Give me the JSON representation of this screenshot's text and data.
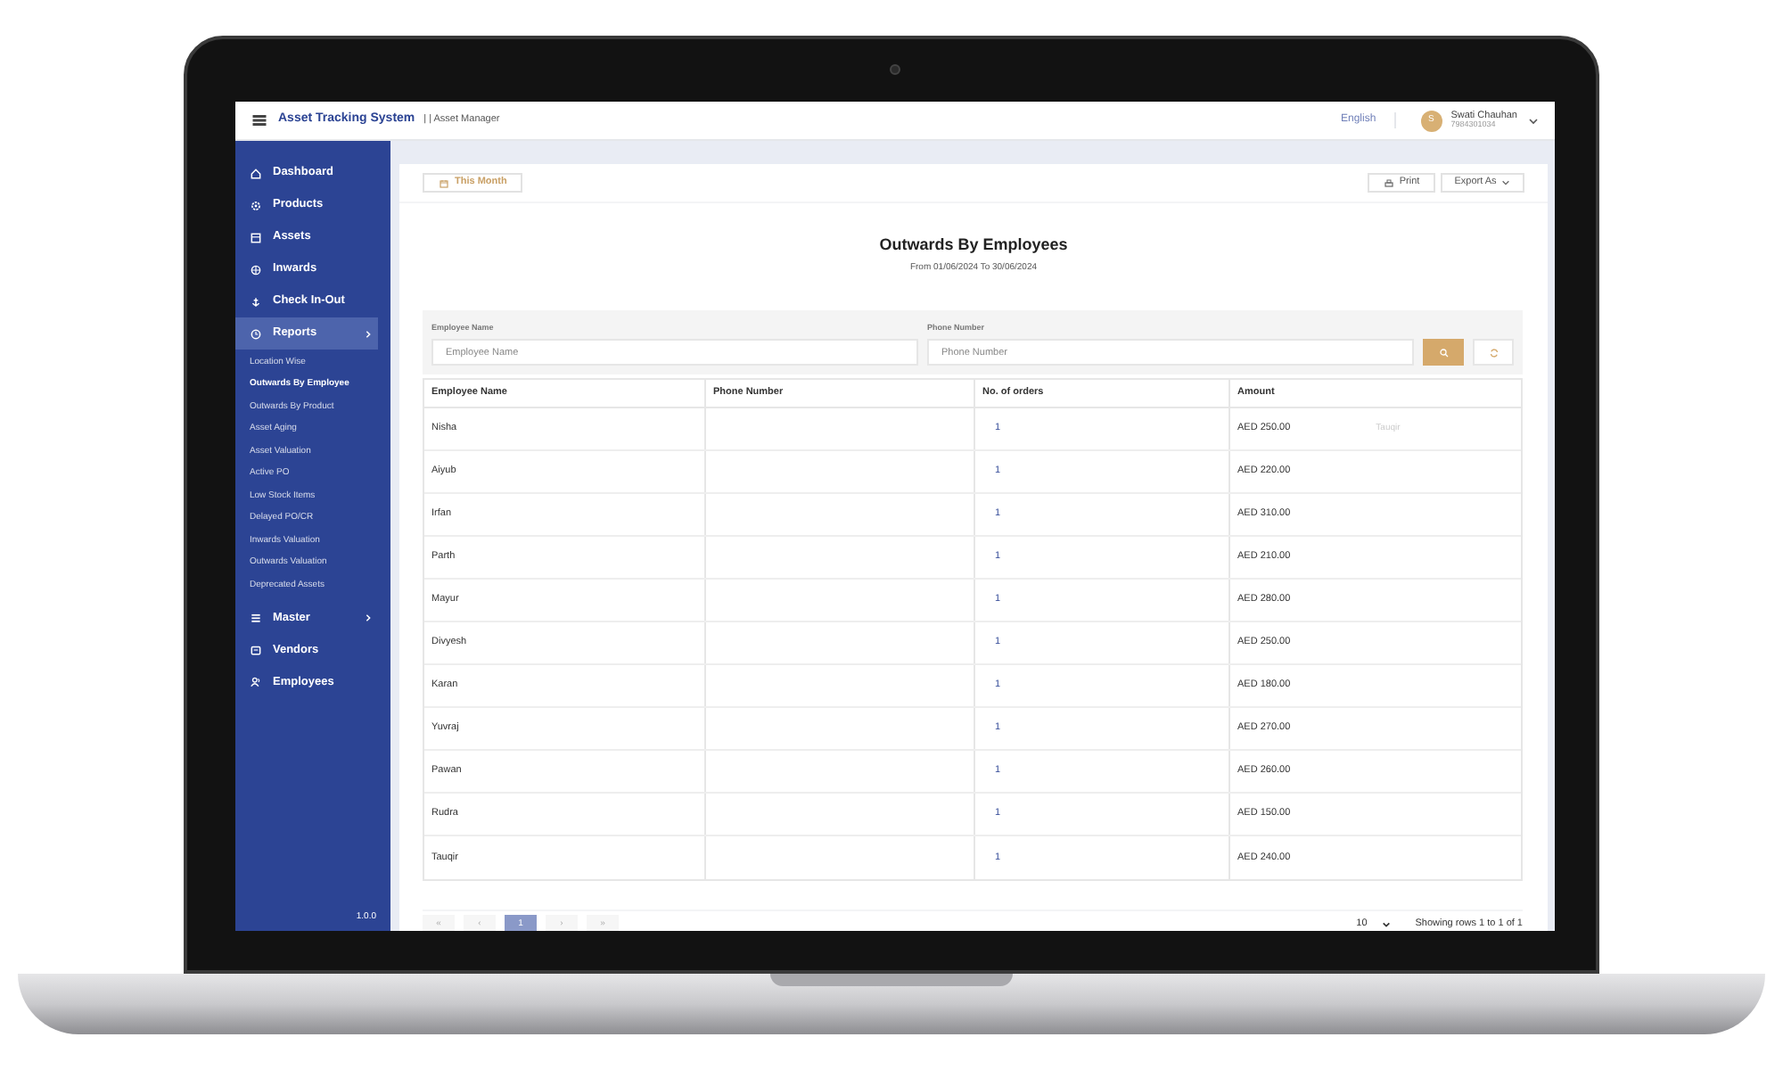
{
  "app": {
    "title": "Asset Tracking System",
    "subtitle": "| | Asset Manager",
    "language": "English",
    "user": {
      "initial": "S",
      "name": "Swati Chauhan",
      "phone": "7984301034"
    }
  },
  "sidebar": {
    "items": [
      {
        "label": "Dashboard",
        "selected": false,
        "submenu": false
      },
      {
        "label": "Products",
        "selected": false,
        "submenu": false
      },
      {
        "label": "Assets",
        "selected": false,
        "submenu": false
      },
      {
        "label": "Inwards",
        "selected": false,
        "submenu": false
      },
      {
        "label": "Check In-Out",
        "selected": false,
        "submenu": false
      },
      {
        "label": "Reports",
        "selected": true,
        "submenu": true,
        "children": [
          {
            "label": "Location Wise",
            "selected": false
          },
          {
            "label": "Outwards By Employee",
            "selected": true
          },
          {
            "label": "Outwards By Product",
            "selected": false
          },
          {
            "label": "Asset Aging",
            "selected": false
          },
          {
            "label": "Asset Valuation",
            "selected": false
          },
          {
            "label": "Active PO",
            "selected": false
          },
          {
            "label": "Low Stock Items",
            "selected": false
          },
          {
            "label": "Delayed PO/CR",
            "selected": false
          },
          {
            "label": "Inwards Valuation",
            "selected": false
          },
          {
            "label": "Outwards Valuation",
            "selected": false
          },
          {
            "label": "Deprecated Assets",
            "selected": false
          }
        ]
      },
      {
        "label": "Master",
        "selected": false,
        "submenu": true
      },
      {
        "label": "Vendors",
        "selected": false,
        "submenu": false
      },
      {
        "label": "Employees",
        "selected": false,
        "submenu": false
      }
    ],
    "version": "1.0.0"
  },
  "toolbar": {
    "period": "This Month",
    "print": "Print",
    "export": "Export As"
  },
  "report": {
    "title": "Outwards By Employees",
    "range": "From 01/06/2024 To 30/06/2024"
  },
  "filters": [
    {
      "label": "Employee Name",
      "placeholder": "Employee Name"
    },
    {
      "label": "Phone Number",
      "placeholder": "Phone Number"
    }
  ],
  "table": {
    "columns": [
      "Employee Name",
      "Phone Number",
      "No. of orders",
      "Amount"
    ],
    "rows": [
      {
        "employee": "Nisha",
        "orders": "1",
        "amount": "AED 250.00",
        "hover_text": "Tauqir"
      },
      {
        "employee": "Aiyub",
        "orders": "1",
        "amount": "AED 220.00"
      },
      {
        "employee": "Irfan",
        "orders": "1",
        "amount": "AED 310.00"
      },
      {
        "employee": "Parth",
        "orders": "1",
        "amount": "AED 210.00"
      },
      {
        "employee": "Mayur",
        "orders": "1",
        "amount": "AED 280.00"
      },
      {
        "employee": "Divyesh",
        "orders": "1",
        "amount": "AED 250.00"
      },
      {
        "employee": "Karan",
        "orders": "1",
        "amount": "AED 180.00"
      },
      {
        "employee": "Yuvraj",
        "orders": "1",
        "amount": "AED 270.00"
      },
      {
        "employee": "Pawan",
        "orders": "1",
        "amount": "AED 260.00"
      },
      {
        "employee": "Rudra",
        "orders": "1",
        "amount": "AED 150.00"
      },
      {
        "employee": "Tauqir",
        "orders": "1",
        "amount": "AED 240.00"
      }
    ]
  },
  "pagination": {
    "pages": [
      {
        "label": "«",
        "selected": false
      },
      {
        "label": "‹",
        "selected": false
      },
      {
        "label": "1",
        "selected": true
      },
      {
        "label": "›",
        "selected": false
      },
      {
        "label": "»",
        "selected": false
      }
    ],
    "page_size": "10",
    "status": "Showing rows 1 to 1 of 1"
  }
}
